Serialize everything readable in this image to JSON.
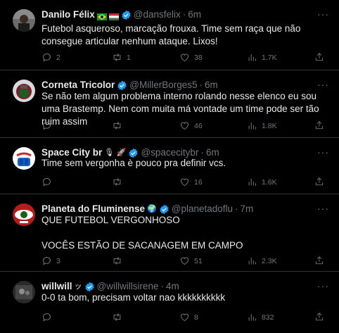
{
  "tweets": [
    {
      "name": "Danilo Félix",
      "badges": "🇧🇷 🇭🇺",
      "handle": "@dansfelix",
      "time": "6m",
      "text": "Futebol asqueroso, marcação frouxa. Time sem raça que não consegue articular nenhum ataque. Lixos!",
      "replies": "2",
      "retweets": "1",
      "likes": "38",
      "views": "1.7K"
    },
    {
      "name": "Corneta Tricolor",
      "badges": "",
      "handle": "@MillerBorges5",
      "time": "6m",
      "text": "Se não tem algum problema interno rolando nesse elenco eu sou uma Brastemp. Nem com muita má vontade um time pode ser tão ruim assim",
      "replies": "",
      "retweets": "",
      "likes": "46",
      "views": "1.8K"
    },
    {
      "name": "Space City br",
      "badges": "🎙 🚀",
      "handle": "@spacecitybr",
      "time": "6m",
      "text": "Time sem vergonha è pouco pra definir vcs.",
      "replies": "",
      "retweets": "",
      "likes": "16",
      "views": "1.6K"
    },
    {
      "name": "Planeta do Fluminense",
      "badges": "🌍",
      "handle": "@planetadoflu",
      "time": "7m",
      "text": "QUE FUTEBOL VERGONHOSO\n\nVOCÊS ESTÃO DE SACANAGEM EM CAMPO",
      "replies": "3",
      "retweets": "",
      "likes": "51",
      "views": "2.3K"
    },
    {
      "name": "willwill",
      "badges": "ッ",
      "handle": "@willwillsirene",
      "time": "4m",
      "text": "0-0 ta bom, precisam voltar nao kkkkkkkkkk",
      "replies": "",
      "retweets": "",
      "likes": "8",
      "views": "832"
    }
  ],
  "separator": "·",
  "more_label": "···",
  "colors": {
    "background": "#000000",
    "text": "#e7e9ea",
    "muted": "#71767b",
    "verified": "#1d9bf0",
    "divider": "#2f3336"
  },
  "icons": [
    "reply-icon",
    "retweet-icon",
    "like-icon",
    "views-icon",
    "share-icon",
    "verified-icon",
    "more-icon"
  ]
}
